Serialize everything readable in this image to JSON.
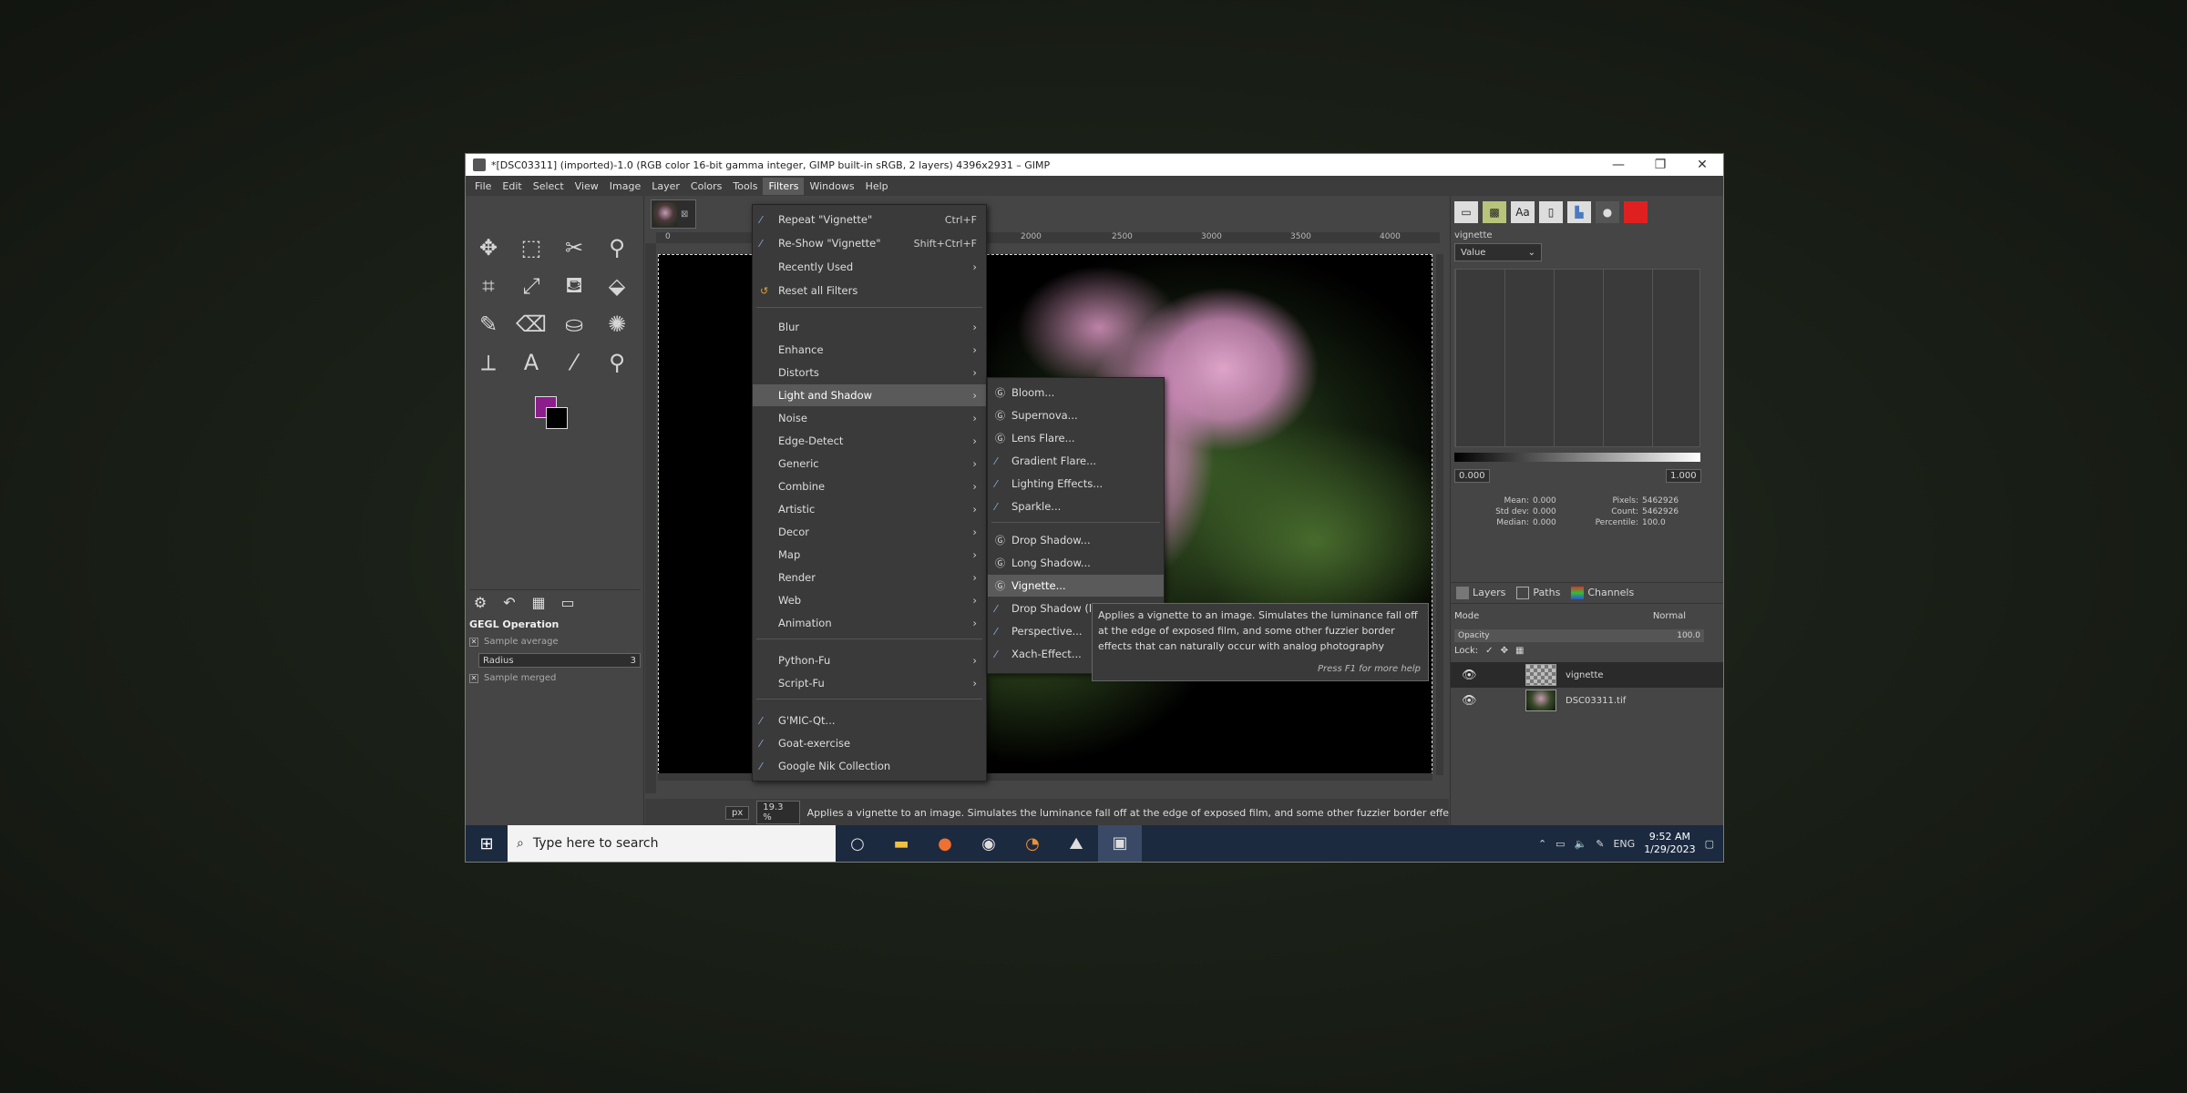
{
  "window": {
    "title": "*[DSC03311] (imported)-1.0 (RGB color 16-bit gamma integer, GIMP built-in sRGB, 2 layers) 4396x2931 – GIMP",
    "minimize": "—",
    "maximize": "❐",
    "close": "✕"
  },
  "menubar": [
    "File",
    "Edit",
    "Select",
    "View",
    "Image",
    "Layer",
    "Colors",
    "Tools",
    "Filters",
    "Windows",
    "Help"
  ],
  "toolbox": {
    "tools": [
      [
        "✥",
        "⬚",
        "✂",
        "⚲"
      ],
      [
        "⌗",
        "⤢",
        "⛾",
        "⬙"
      ],
      [
        "✎",
        "⌫",
        "⛀",
        "✺"
      ],
      [
        "⟂",
        "A",
        "⁄",
        "⚲"
      ]
    ],
    "tool_names": [
      [
        "move-tool-icon",
        "rect-select-icon",
        "scissors-icon",
        "fuzzy-select-icon"
      ],
      [
        "crop-icon",
        "transform-icon",
        "warp-icon",
        "fill-icon"
      ],
      [
        "paintbrush-icon",
        "eraser-icon",
        "clone-icon",
        "heal-icon"
      ],
      [
        "paths-icon",
        "text-icon",
        "color-picker-icon",
        "zoom-icon"
      ]
    ],
    "fg_color": "#8b1e8b",
    "bg_color": "#000000",
    "gegl_title": "GEGL Operation",
    "sample_average": "Sample average",
    "radius_label": "Radius",
    "radius_value": "3",
    "sample_merged": "Sample merged"
  },
  "canvas": {
    "ruler_ticks": [
      "0",
      "2000",
      "2500",
      "3000",
      "3500",
      "4000"
    ],
    "unit": "px",
    "zoom": "19.3 %",
    "status_message": "Applies a vignette to an image. Simulates the luminance fall off at the edge of exposed film, and some other fuzzier border effects t..."
  },
  "filters_menu": {
    "top_items": [
      {
        "label": "Repeat \"Vignette\"",
        "accel": "Ctrl+F"
      },
      {
        "label": "Re-Show \"Vignette\"",
        "accel": "Shift+Ctrl+F"
      },
      {
        "label": "Recently Used",
        "arrow": "›"
      },
      {
        "label": "Reset all Filters"
      }
    ],
    "categories": [
      "Blur",
      "Enhance",
      "Distorts",
      "Light and Shadow",
      "Noise",
      "Edge-Detect",
      "Generic",
      "Combine",
      "Artistic",
      "Decor",
      "Map",
      "Render",
      "Web",
      "Animation"
    ],
    "scripts": [
      "Python-Fu",
      "Script-Fu"
    ],
    "plugins": [
      "G'MIC-Qt...",
      "Goat-exercise",
      "Google Nik Collection"
    ],
    "arrow": "›"
  },
  "light_shadow_menu": {
    "group1": [
      "Bloom...",
      "Supernova...",
      "Lens Flare...",
      "Gradient Flare...",
      "Lighting Effects...",
      "Sparkle..."
    ],
    "group2": [
      "Drop Shadow...",
      "Long Shadow...",
      "Vignette...",
      "Drop Shadow (le",
      "Perspective...",
      "Xach-Effect..."
    ]
  },
  "tooltip": {
    "text": "Applies a vignette to an image. Simulates the luminance fall off at the edge of exposed film, and some other fuzzier border effects that can naturally occur with analog photography",
    "hint": "Press F1 for more help"
  },
  "dock": {
    "histogram_label": "vignette",
    "channel": "Value",
    "range_min": "0.000",
    "range_max": "1.000",
    "stats": [
      {
        "k": "Mean:",
        "v": "0.000",
        "k2": "Pixels:",
        "v2": "5462926"
      },
      {
        "k": "Std dev:",
        "v": "0.000",
        "k2": "Count:",
        "v2": "5462926"
      },
      {
        "k": "Median:",
        "v": "0.000",
        "k2": "Percentile:",
        "v2": "100.0"
      }
    ],
    "tabs": [
      "Layers",
      "Paths",
      "Channels"
    ],
    "mode_label": "Mode",
    "mode_value": "Normal",
    "opacity_label": "Opacity",
    "opacity_value": "100.0",
    "lock_label": "Lock:",
    "layers": [
      {
        "name": "vignette"
      },
      {
        "name": "DSC03311.tif"
      }
    ]
  },
  "taskbar": {
    "search_placeholder": "Type here to search",
    "language": "ENG",
    "time": "9:52 AM",
    "date": "1/29/2023"
  }
}
